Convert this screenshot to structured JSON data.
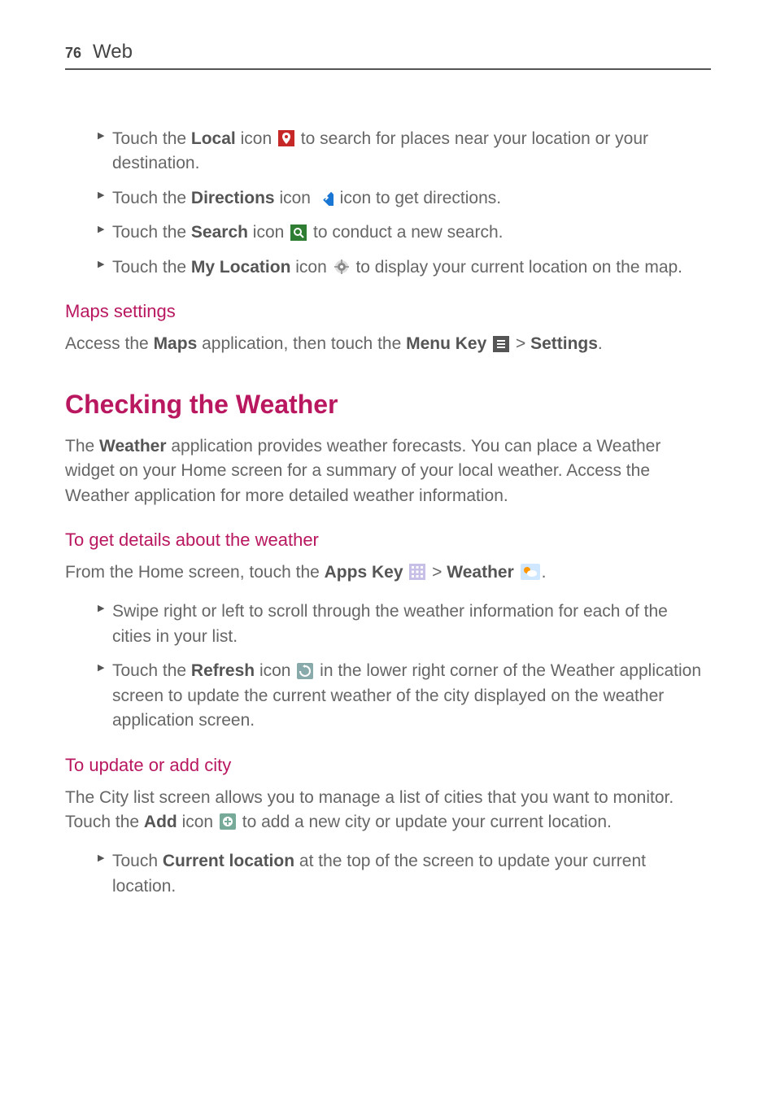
{
  "header": {
    "page_number": "76",
    "title": "Web"
  },
  "top_bullets": [
    {
      "pre": "Touch the ",
      "bold": "Local",
      "mid": " icon ",
      "icon": "local-icon",
      "post": " to search for places near your location or your destination."
    },
    {
      "pre": "Touch the ",
      "bold": "Directions",
      "mid": " icon ",
      "icon": "directions-icon",
      "post": " icon to get directions."
    },
    {
      "pre": "Touch the ",
      "bold": "Search",
      "mid": " icon ",
      "icon": "search-icon",
      "post": " to conduct a new search."
    },
    {
      "pre": "Touch the ",
      "bold": "My Location",
      "mid": " icon ",
      "icon": "my-location-icon",
      "post": " to display your current location on the map."
    }
  ],
  "maps_settings": {
    "heading": "Maps settings",
    "text_pre": "Access the ",
    "text_bold1": "Maps",
    "text_mid1": " application, then touch the ",
    "text_bold2": "Menu Key",
    "text_mid2": " ",
    "text_mid3": " > ",
    "text_bold3": "Settings",
    "text_post": "."
  },
  "weather": {
    "heading": "Checking the Weather",
    "intro_pre": "The ",
    "intro_bold": "Weather",
    "intro_post": " application provides weather forecasts. You can place a Weather widget on your Home screen for a summary of your local weather. Access the Weather application for more detailed weather information."
  },
  "details": {
    "heading": "To get details about the weather",
    "line_pre": "From the Home screen, touch the ",
    "line_bold1": "Apps Key",
    "line_mid1": " ",
    "line_mid2": " > ",
    "line_bold2": "Weather",
    "line_mid3": " ",
    "line_post": ".",
    "bullets": [
      {
        "full": "Swipe right or left to scroll through the weather information for each of the cities in your list."
      },
      {
        "pre": "Touch the ",
        "bold": "Refresh",
        "mid": " icon ",
        "icon": "refresh-icon",
        "post": " in the lower right corner of the Weather application screen to update the current weather of the city displayed on the weather application screen."
      }
    ]
  },
  "update_city": {
    "heading": "To update or add city",
    "text_pre": "The City list screen allows you to manage a list of cities that you want to monitor. Touch the ",
    "text_bold": "Add",
    "text_mid": " icon ",
    "text_post": " to add a new city or update your current location.",
    "bullets": [
      {
        "pre": "Touch ",
        "bold": "Current location",
        "post": " at the top of the screen to update your current location."
      }
    ]
  }
}
